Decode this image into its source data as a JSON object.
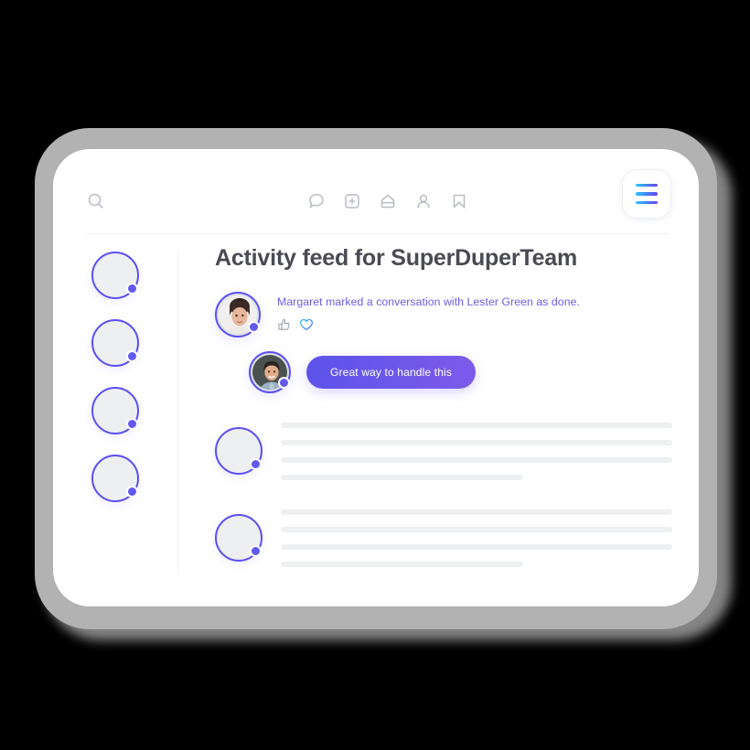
{
  "device": {
    "frame_color": "#b2b2b2",
    "screen_color": "#ffffff",
    "background_color": "#000000"
  },
  "topbar": {
    "search_icon": "search-icon",
    "nav_icons": [
      {
        "name": "chat-bubble-icon",
        "label": "Messages"
      },
      {
        "name": "add-square-icon",
        "label": "Add"
      },
      {
        "name": "home-icon",
        "label": "Home"
      },
      {
        "name": "user-icon",
        "label": "Profile"
      },
      {
        "name": "bookmark-icon",
        "label": "Bookmarks"
      }
    ],
    "menu_button": {
      "name": "hamburger-menu-button",
      "gradient_start": "#2ec5ff",
      "gradient_end": "#6b3ff0"
    }
  },
  "sidebar": {
    "items": [
      {
        "name": "sidebar-avatar-1",
        "status": "online"
      },
      {
        "name": "sidebar-avatar-2",
        "status": "online"
      },
      {
        "name": "sidebar-avatar-3",
        "status": "online"
      },
      {
        "name": "sidebar-avatar-4",
        "status": "online"
      }
    ],
    "ring_color": "#5a4ff3",
    "fill_color": "#eeeff1",
    "dot_color": "#6359f0"
  },
  "main": {
    "title": "Activity feed for SuperDuperTeam",
    "title_color": "#4a4a53",
    "post": {
      "author": "Margaret",
      "message": "Margaret marked a conversation with Lester Green as done.",
      "message_color": "#6c5ce7",
      "reactions": [
        {
          "name": "thumbs-up-icon",
          "color": "#9aa0ab"
        },
        {
          "name": "heart-icon",
          "color": "#3c8ef0"
        }
      ]
    },
    "reply": {
      "text": "Great way to handle this",
      "bubble_gradient_start": "#5b53ea",
      "bubble_gradient_end": "#7d5beb",
      "text_color": "#ffffff"
    },
    "skeleton_rows": [
      {
        "name": "skeleton-row-1",
        "line_widths": [
          "100%",
          "100%",
          "100%",
          "62%"
        ]
      },
      {
        "name": "skeleton-row-2",
        "line_widths": [
          "100%",
          "100%",
          "100%",
          "62%"
        ]
      }
    ],
    "skeleton_color": "#eeeff1"
  }
}
